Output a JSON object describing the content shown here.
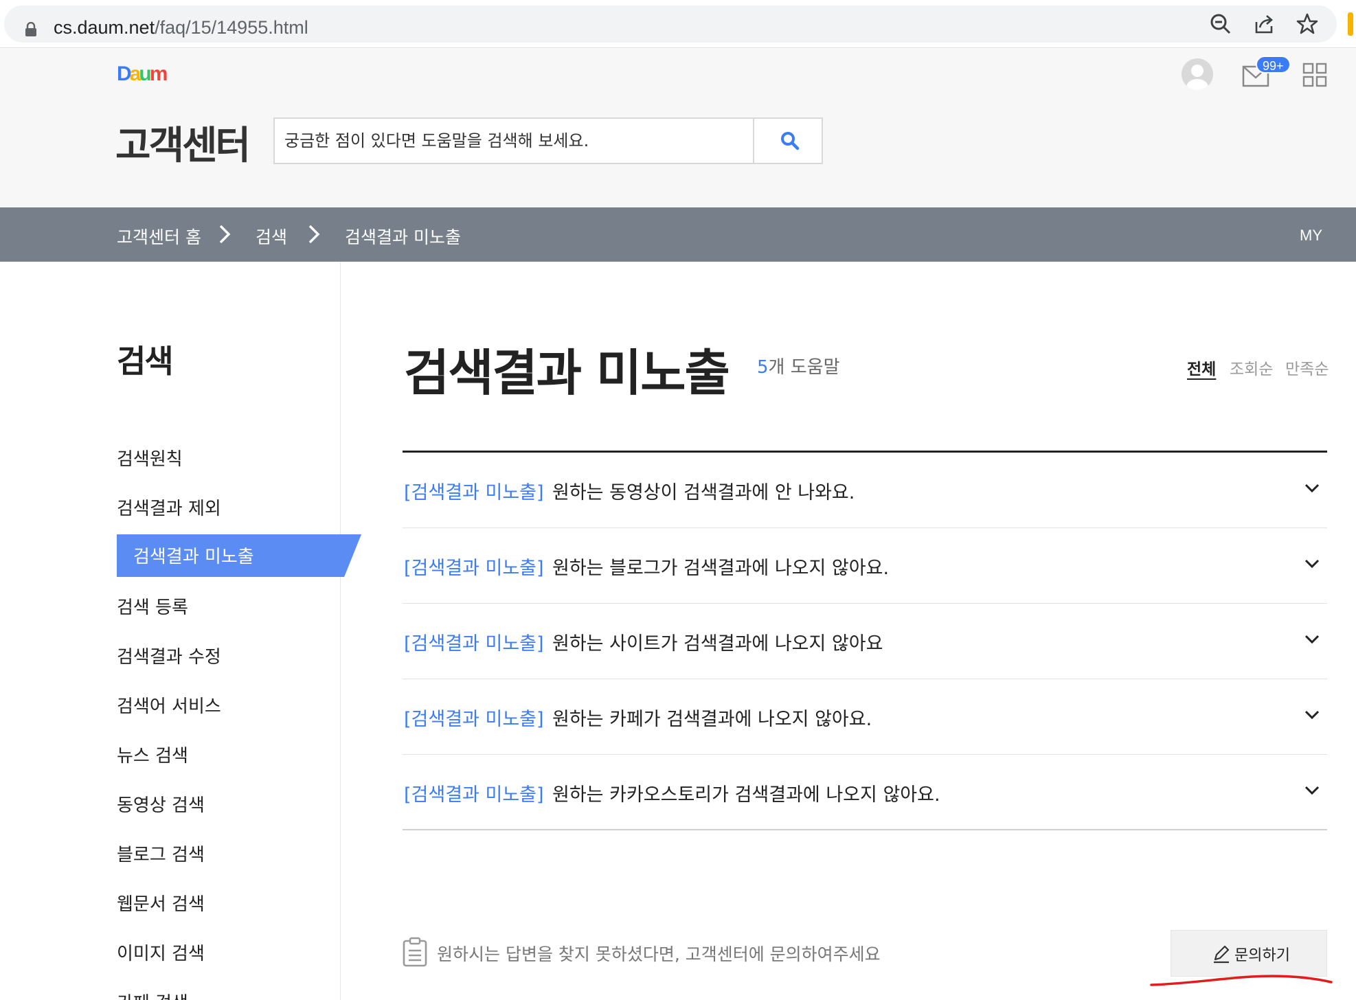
{
  "browser": {
    "url_host": "cs.daum.net",
    "url_path": "/faq/15/14955.html"
  },
  "header": {
    "logo": [
      "D",
      "a",
      "u",
      "m"
    ],
    "title": "고객센터",
    "search_placeholder": "궁금한 점이 있다면 도움말을 검색해 보세요.",
    "mail_badge": "99+"
  },
  "breadcrumb": {
    "items": [
      "고객센터 홈",
      "검색",
      "검색결과 미노출"
    ],
    "my": "MY"
  },
  "sidebar": {
    "title": "검색",
    "items": [
      "검색원칙",
      "검색결과 제외",
      "검색결과 미노출",
      "검색 등록",
      "검색결과 수정",
      "검색어 서비스",
      "뉴스 검색",
      "동영상 검색",
      "블로그 검색",
      "웹문서 검색",
      "이미지 검색",
      "카페 검색"
    ],
    "active_index": 2
  },
  "main": {
    "title": "검색결과 미노출",
    "count_num": "5",
    "count_suffix": "개 도움말",
    "sort": [
      "전체",
      "조회순",
      "만족순"
    ],
    "faqs": [
      {
        "tag": "[검색결과 미노출]",
        "text": "원하는 동영상이 검색결과에 안 나와요."
      },
      {
        "tag": "[검색결과 미노출]",
        "text": "원하는 블로그가 검색결과에 나오지 않아요."
      },
      {
        "tag": "[검색결과 미노출]",
        "text": "원하는 사이트가 검색결과에 나오지 않아요"
      },
      {
        "tag": "[검색결과 미노출]",
        "text": "원하는 카페가 검색결과에 나오지 않아요."
      },
      {
        "tag": "[검색결과 미노출]",
        "text": "원하는 카카오스토리가 검색결과에 나오지 않아요."
      }
    ],
    "footer_text": "원하시는 답변을 찾지 못하셨다면, 고객센터에 문의하여주세요",
    "ask_button": "문의하기"
  },
  "colors": {
    "accent": "#3b7cf4",
    "breadcrumb_bg": "#767f8a",
    "sidebar_active": "#5a8cf4"
  }
}
